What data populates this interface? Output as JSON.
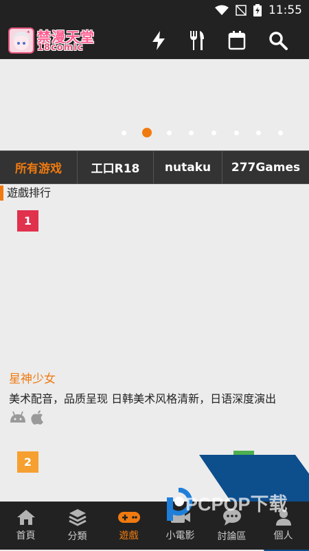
{
  "status": {
    "time": "11:55"
  },
  "app": {
    "logo_line1": "禁漫天堂",
    "logo_line2": "18comic"
  },
  "tabs": [
    {
      "label": "所有游戏",
      "active": true
    },
    {
      "label": "工口R18",
      "active": false
    },
    {
      "label": "nutaku",
      "active": false
    },
    {
      "label": "277Games",
      "active": false
    }
  ],
  "section": {
    "title": "遊戲排行"
  },
  "games": [
    {
      "rank": "1",
      "rank_color": "#e0314d",
      "title": "星神少女",
      "desc": "美术配音，品质呈现 日韩美术风格清新，日语深度演出",
      "platforms": [
        "android-icon",
        "apple-icon"
      ]
    },
    {
      "rank": "2",
      "rank_color": "#f5a030"
    }
  ],
  "nav": [
    {
      "label": "首頁",
      "icon": "home-icon"
    },
    {
      "label": "分類",
      "icon": "layers-icon"
    },
    {
      "label": "遊戲",
      "icon": "gamepad-icon",
      "active": true
    },
    {
      "label": "小電影",
      "icon": "video-icon"
    },
    {
      "label": "討論區",
      "icon": "chat-icon"
    },
    {
      "label": "個人",
      "icon": "person-icon"
    }
  ],
  "carousel": {
    "total": 8,
    "active": 1
  },
  "watermark": {
    "text": "PCPOP下载"
  },
  "colors": {
    "accent": "#f07a10",
    "bar": "#222222",
    "tabs_bg": "#333333",
    "overlay_blue": "#0d4e8c"
  }
}
